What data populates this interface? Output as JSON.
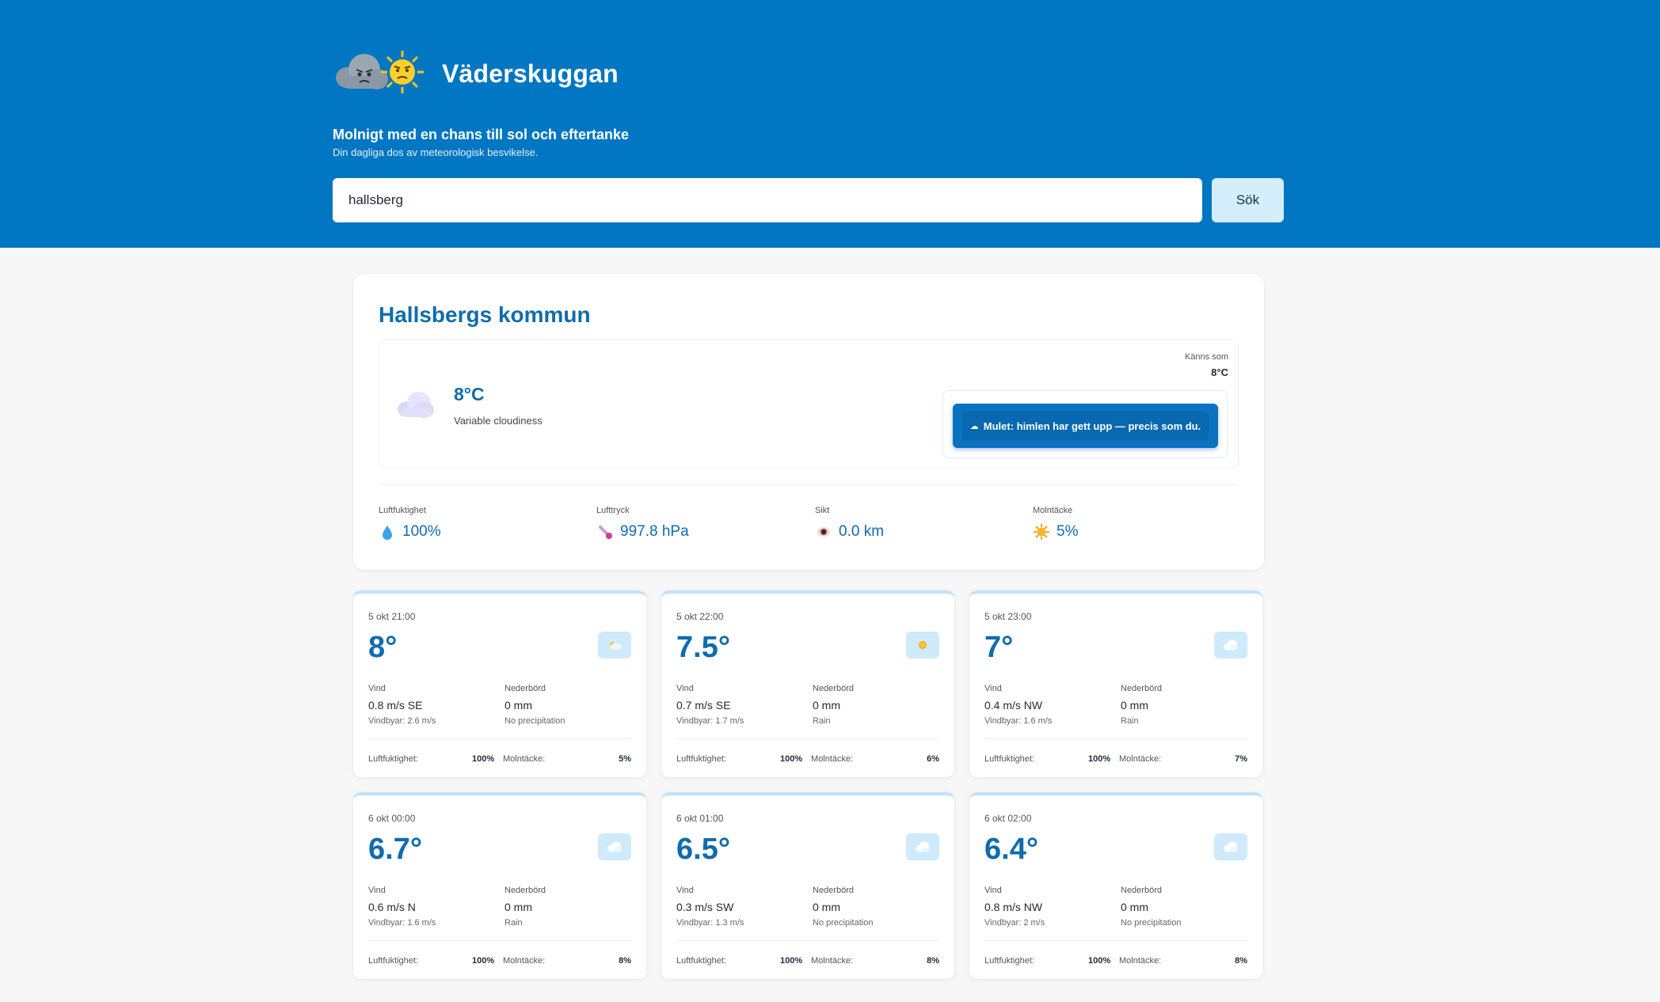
{
  "header": {
    "brand": "Väderskuggan",
    "tagline": "Molnigt med en chans till sol och eftertanke",
    "subtagline": "Din dagliga dos av meteorologisk besvikelse.",
    "search_value": "hallsberg",
    "search_button": "Sök",
    "logo_icons": [
      "grumpy-cloud-icon",
      "grumpy-sun-icon"
    ]
  },
  "current": {
    "location": "Hallsbergs kommun",
    "temperature": "8°C",
    "description": "Variable cloudiness",
    "icon": "cloud-icon",
    "feels_like_label": "Känns som",
    "feels_like_value": "8°C",
    "quip": "Mulet: himlen har gett upp — precis som du.",
    "stats": [
      {
        "label": "Luftfuktighet",
        "value": "100%",
        "icon": "droplet-icon"
      },
      {
        "label": "Lufttryck",
        "value": "997.8 hPa",
        "icon": "thermometer-icon"
      },
      {
        "label": "Sikt",
        "value": "0.0 km",
        "icon": "eye-icon"
      },
      {
        "label": "Molntäcke",
        "value": "5%",
        "icon": "sun-icon"
      }
    ]
  },
  "labels": {
    "wind": "Vind",
    "precip": "Nederbörd",
    "humidity": "Luftfuktighet:",
    "cloud": "Molntäcke:"
  },
  "forecast": [
    {
      "time": "5 okt 21:00",
      "temp": "8°",
      "icon": "partly-cloudy-icon",
      "wind": "0.8 m/s SE",
      "gusts": "Vindbyar: 2.6 m/s",
      "precip": "0 mm",
      "precip_type": "No precipitation",
      "humidity": "100%",
      "cloud": "5%"
    },
    {
      "time": "5 okt 22:00",
      "temp": "7.5°",
      "icon": "sun-icon",
      "wind": "0.7 m/s SE",
      "gusts": "Vindbyar: 1.7 m/s",
      "precip": "0 mm",
      "precip_type": "Rain",
      "humidity": "100%",
      "cloud": "6%"
    },
    {
      "time": "5 okt 23:00",
      "temp": "7°",
      "icon": "cloud-icon",
      "wind": "0.4 m/s NW",
      "gusts": "Vindbyar: 1.6 m/s",
      "precip": "0 mm",
      "precip_type": "Rain",
      "humidity": "100%",
      "cloud": "7%"
    },
    {
      "time": "6 okt 00:00",
      "temp": "6.7°",
      "icon": "cloud-icon",
      "wind": "0.6 m/s N",
      "gusts": "Vindbyar: 1.6 m/s",
      "precip": "0 mm",
      "precip_type": "Rain",
      "humidity": "100%",
      "cloud": "8%"
    },
    {
      "time": "6 okt 01:00",
      "temp": "6.5°",
      "icon": "cloud-icon",
      "wind": "0.3 m/s SW",
      "gusts": "Vindbyar: 1.3 m/s",
      "precip": "0 mm",
      "precip_type": "No precipitation",
      "humidity": "100%",
      "cloud": "8%"
    },
    {
      "time": "6 okt 02:00",
      "temp": "6.4°",
      "icon": "cloud-icon",
      "wind": "0.8 m/s NW",
      "gusts": "Vindbyar: 2 m/s",
      "precip": "0 mm",
      "precip_type": "No precipitation",
      "humidity": "100%",
      "cloud": "8%"
    }
  ],
  "colors": {
    "header": "#0176c3",
    "accent": "#0f6cae",
    "icon_bg": "#cfeafb"
  }
}
